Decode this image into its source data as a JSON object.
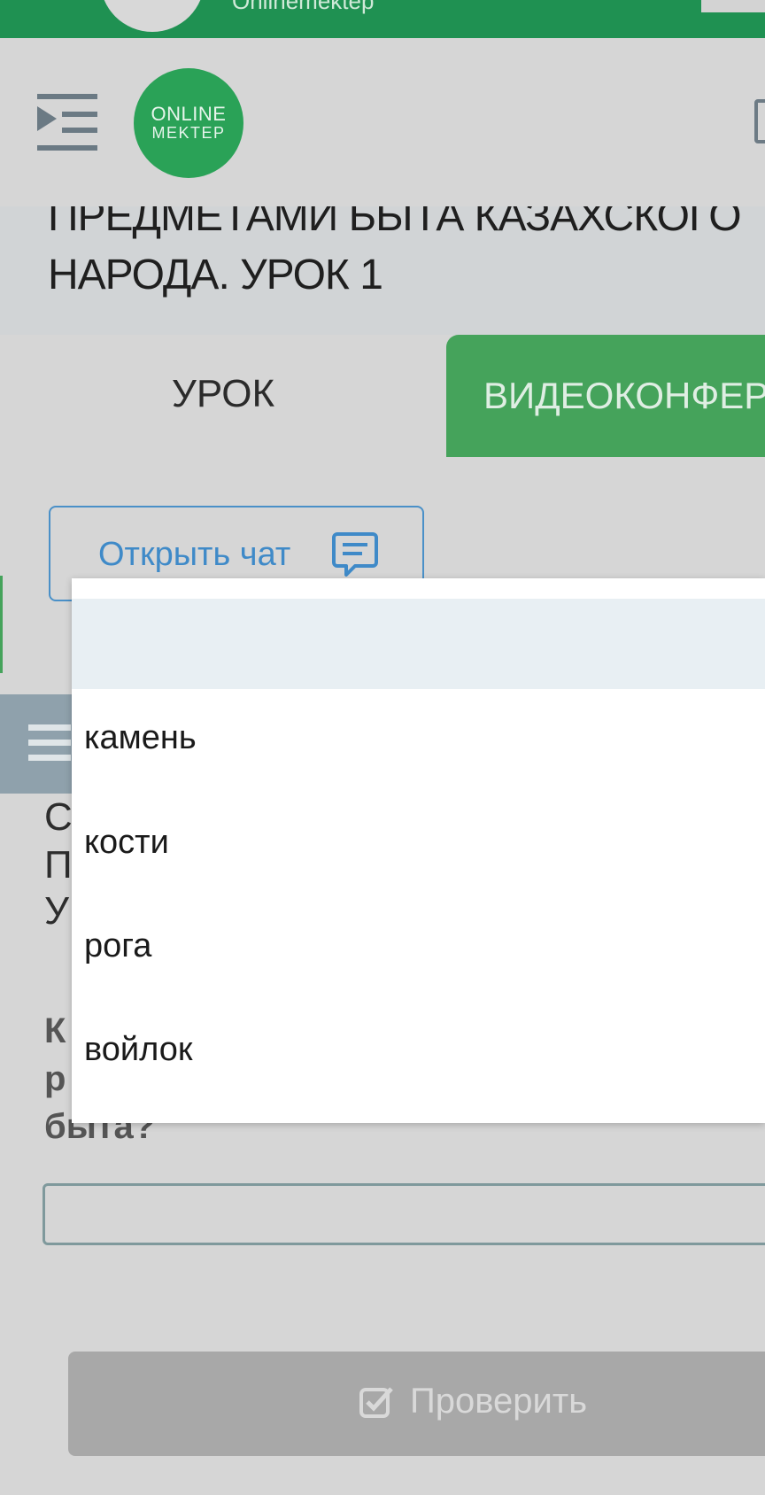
{
  "topbar": {
    "title": "Onlinemektep"
  },
  "logo": {
    "line1": "ONLINE",
    "line2": "MEKTEP"
  },
  "lesson": {
    "title_line1": "ПРЕДМЕТАМИ БЫТА КАЗАХСКОГО",
    "title_line2": "НАРОДА. УРОК 1"
  },
  "tabs": [
    {
      "label": "УРОК"
    },
    {
      "label": "ВИДЕОКОНФЕРЕНЦИЯ"
    }
  ],
  "chat_button": {
    "label": "Открыть чат"
  },
  "content": {
    "partial_lines": [
      "С",
      "П",
      "У"
    ],
    "question_partial": [
      "К",
      "р",
      "быта?"
    ]
  },
  "check_button": {
    "label": "Проверить"
  },
  "dropdown": {
    "options": [
      "",
      "камень",
      "кости",
      "рога",
      "войлок"
    ]
  },
  "colors": {
    "brand_green": "#1f9152",
    "tab_green": "#45a35b",
    "link_blue": "#3f8ac8"
  }
}
